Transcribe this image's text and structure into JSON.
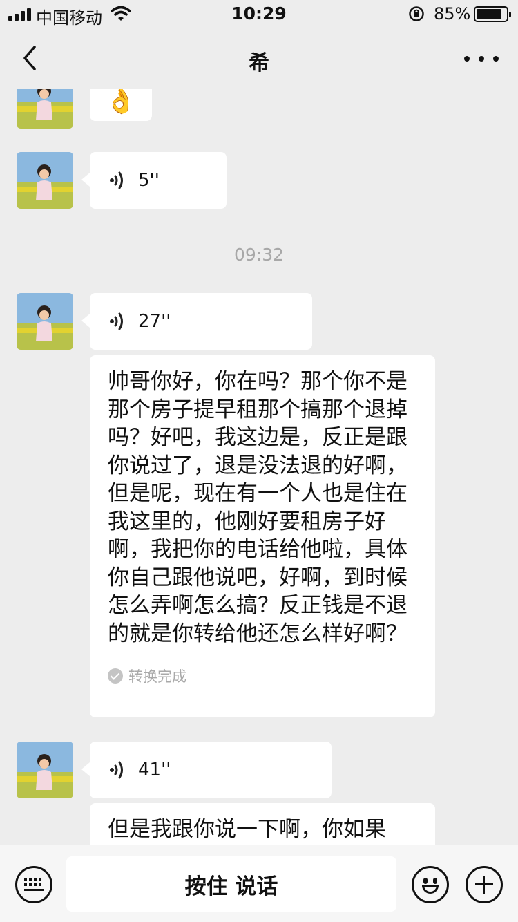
{
  "status_bar": {
    "carrier": "中国移动",
    "time": "10:29",
    "battery_percent": "85%",
    "battery_level": 0.85,
    "signal_bars": 4
  },
  "nav": {
    "title": "希",
    "back_icon": "chevron-left-icon",
    "more_icon": "more-dots-icon"
  },
  "messages": [
    {
      "type": "emoji",
      "content": "👌"
    },
    {
      "type": "voice",
      "duration": "5''"
    },
    {
      "type": "time",
      "text": "09:32"
    },
    {
      "type": "voice",
      "duration": "27''"
    },
    {
      "type": "transcript",
      "text": "帅哥你好，你在吗？那个你不是那个房子提早租那个搞那个退掉吗？好吧，我这边是，反正是跟你说过了，退是没法退的好啊，但是呢，现在有一个人也是住在我这里的，他刚好要租房子好啊，我把你的电话给他啦，具体你自己跟他说吧，好啊，到时候怎么弄啊怎么搞？反正钱是不退的就是你转给他还怎么样好啊？",
      "status": "转换完成"
    },
    {
      "type": "voice",
      "duration": "41''"
    },
    {
      "type": "transcript",
      "text": "但是我跟你说一下啊，你如果"
    }
  ],
  "input_bar": {
    "talk_label": "按住 说话",
    "keyboard_icon": "keyboard-icon",
    "emoji_icon": "smiley-icon",
    "plus_icon": "plus-icon"
  },
  "colors": {
    "background": "#ededed",
    "bubble": "#ffffff",
    "time_text": "#a8a8a8"
  }
}
